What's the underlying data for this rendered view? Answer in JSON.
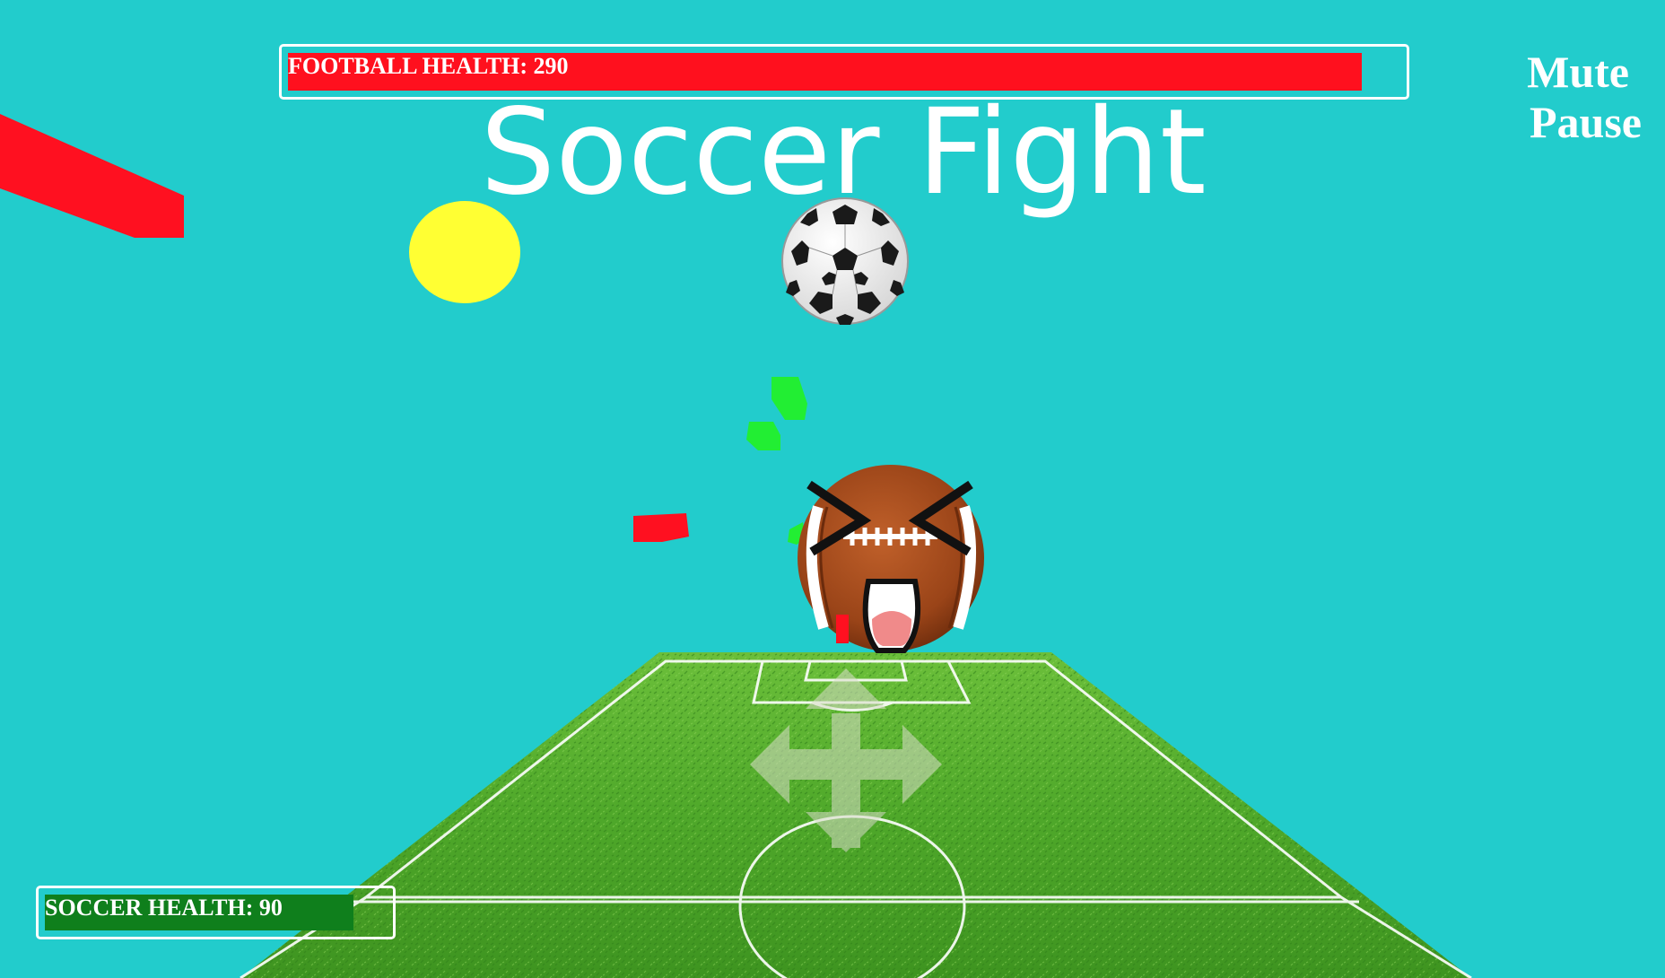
{
  "title": "Soccer Fight",
  "hud": {
    "football_health_label": "FOOTBALL HEALTH: 290",
    "football_health_value": 290,
    "soccer_health_label": "SOCCER HEALTH: 90",
    "soccer_health_value": 90
  },
  "menu": {
    "mute_label": "Mute",
    "pause_label": "Pause"
  },
  "colors": {
    "sky": "#22cccc",
    "football_health_bar": "#ff101e",
    "soccer_health_bar": "#0f7f1c",
    "hud_text": "#ffffff",
    "projectile_red": "#ff1020",
    "projectile_green": "#22ee33",
    "sun": "#ffff33"
  },
  "icons": {
    "move_control": "four-way-arrow-icon",
    "soccer_ball": "soccer-ball-icon",
    "football_enemy": "angry-football-icon"
  }
}
